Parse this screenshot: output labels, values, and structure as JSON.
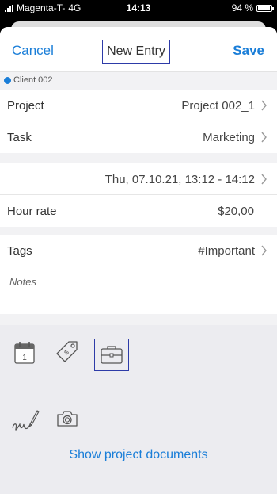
{
  "status_bar": {
    "carrier": "Magenta-T-",
    "network": "4G",
    "time": "14:13",
    "battery_percent": "94 %",
    "battery_level": 0.94
  },
  "nav": {
    "cancel_label": "Cancel",
    "title": "New Entry",
    "save_label": "Save"
  },
  "client": {
    "name": "Client 002",
    "color": "#1a7ed8"
  },
  "fields": {
    "project_label": "Project",
    "project_value": "Project 002_1",
    "task_label": "Task",
    "task_value": "Marketing",
    "datetime_value": "Thu, 07.10.21, 13:12 - 14:12",
    "hour_rate_label": "Hour rate",
    "hour_rate_value": "$20,00",
    "tags_label": "Tags",
    "tags_value": "#Important",
    "notes_placeholder": "Notes"
  },
  "toolbar": {
    "calendar_day": "1",
    "icons": [
      "calendar-icon",
      "price-tag-icon",
      "briefcase-icon",
      "signature-icon",
      "camera-icon"
    ],
    "show_documents_label": "Show project documents"
  },
  "colors": {
    "accent": "#1a7ed8",
    "selection_outline": "#2d3ba8"
  }
}
